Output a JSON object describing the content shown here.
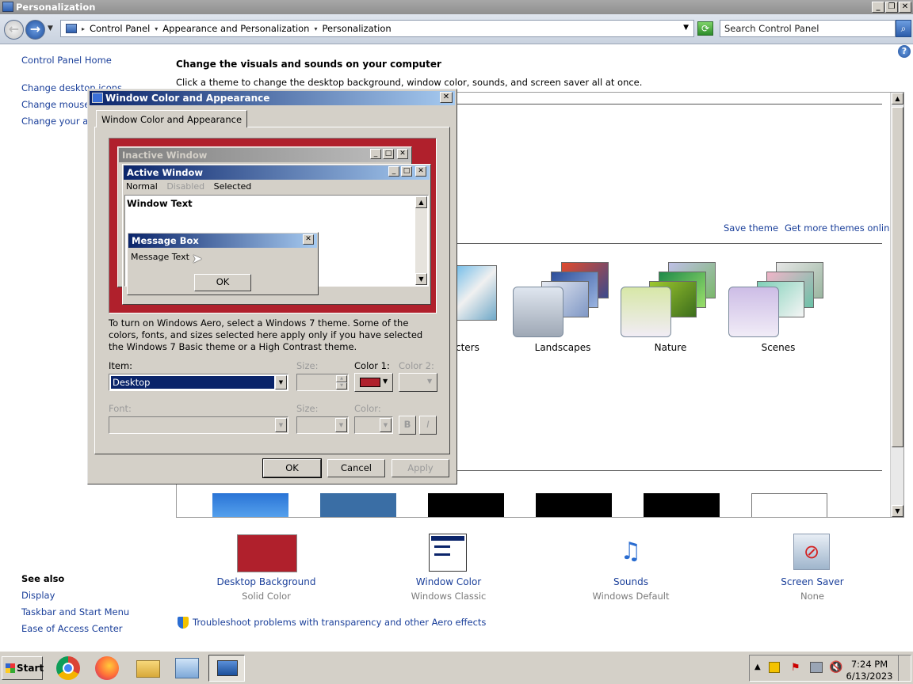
{
  "window": {
    "title": "Personalization"
  },
  "address": {
    "crumbs": [
      "Control Panel",
      "Appearance and Personalization",
      "Personalization"
    ],
    "search_placeholder": "Search Control Panel"
  },
  "left_panel": {
    "home": "Control Panel Home",
    "links": [
      "Change desktop icons",
      "Change mouse pointers",
      "Change your account picture"
    ],
    "see_also_title": "See also",
    "see_also": [
      "Display",
      "Taskbar and Start Menu",
      "Ease of Access Center"
    ]
  },
  "main": {
    "heading": "Change the visuals and sounds on your computer",
    "subheading": "Click a theme to change the desktop background, window color, sounds, and screen saver all at once.",
    "save_theme": "Save theme",
    "get_more": "Get more themes online",
    "themes": [
      "cters",
      "Landscapes",
      "Nature",
      "Scenes"
    ],
    "troubleshoot": "Troubleshoot problems with transparency and other Aero effects"
  },
  "settings": [
    {
      "title": "Desktop Background",
      "sub": "Solid Color"
    },
    {
      "title": "Window Color",
      "sub": "Windows Classic"
    },
    {
      "title": "Sounds",
      "sub": "Windows Default"
    },
    {
      "title": "Screen Saver",
      "sub": "None"
    }
  ],
  "dialog": {
    "title": "Window Color and Appearance",
    "tab": "Window Color and Appearance",
    "preview": {
      "inactive_title": "Inactive Window",
      "active_title": "Active Window",
      "menu": [
        "Normal",
        "Disabled",
        "Selected"
      ],
      "window_text": "Window Text",
      "msgbox_title": "Message Box",
      "msgbox_text": "Message Text",
      "msgbox_ok": "OK"
    },
    "info": "To turn on Windows Aero, select a Windows 7 theme.  Some of the colors, fonts, and sizes selected here apply only if you have selected the Windows 7 Basic theme or a High Contrast theme.",
    "labels": {
      "item": "Item:",
      "size": "Size:",
      "color1": "Color 1:",
      "color2": "Color 2:",
      "font": "Font:",
      "size2": "Size:",
      "color": "Color:"
    },
    "item_value": "Desktop",
    "bold": "B",
    "italic": "I",
    "buttons": {
      "ok": "OK",
      "cancel": "Cancel",
      "apply": "Apply"
    }
  },
  "taskbar": {
    "start": "Start",
    "time": "7:24 PM",
    "date": "6/13/2023"
  },
  "colors": {
    "desktop": "#b0202c",
    "active_title_start": "#0a246a",
    "active_title_end": "#a6caf0",
    "link": "#1a3f9a"
  }
}
